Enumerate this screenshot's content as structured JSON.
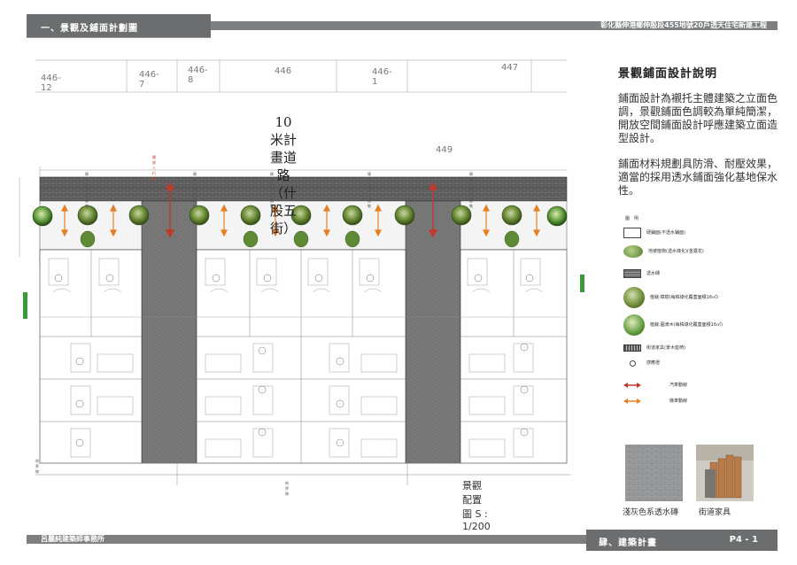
{
  "header": {
    "section": "一、景觀及鋪面計劃圖",
    "project": "彰化縣伸港鄉伸殷段455地號20戶透天住宅新建工程"
  },
  "footer": {
    "office": "呂麗純建築師事務所",
    "chapter": "肆、建築計畫",
    "page": "P4 - 1"
  },
  "panel": {
    "title": "景觀鋪面設計說明",
    "para1": "鋪面設計為襯托主體建築之立面色調，景觀鋪面色調較為單純簡潔，開放空間鋪面設計呼應建築立面造型設計。",
    "para2": "鋪面材料規劃具防滑、耐壓效果，適當的採用透水鋪面強化基地保水性。",
    "legend_title": "圖　例",
    "legend": [
      {
        "icon": "hardscape-box-icon",
        "label": "硬鋪面(不透水鋪面)"
      },
      {
        "icon": "groundcover-shrub-icon",
        "label": "地被植物(透水綠化)(金露花)"
      },
      {
        "icon": "permeable-brick-icon",
        "label": "透水磚"
      },
      {
        "icon": "tree-camphor-icon",
        "label": "植栽:樟樹(每株綠化覆蓋面積16㎡)"
      },
      {
        "icon": "tree-round-icon",
        "label": "植栽:圓滴木(每株綠化覆蓋面積16㎡)"
      },
      {
        "icon": "street-furniture-icon",
        "label": "街道家具(景木座椅)"
      },
      {
        "icon": "sensor-light-icon",
        "label": "感應燈"
      },
      {
        "icon": "car-route-icon",
        "label": "汽車動線"
      },
      {
        "icon": "bike-route-icon",
        "label": "機車動線"
      }
    ],
    "photo1_caption": "淺灰色系透水磚",
    "photo2_caption": "街道家具",
    "colors": {
      "car_route": "#c0392b",
      "bike_route": "#e67e22",
      "band": "#7d7f80"
    }
  },
  "plan": {
    "road_title_1": "10米計畫道路",
    "road_title_2": "（什股五街）",
    "lots": [
      "446-12",
      "446-7",
      "446-8",
      "446",
      "446-1",
      "447",
      "449"
    ],
    "scale_label": "景觀配置圖 S : 1/200",
    "marks": {
      "ramp": "開放人行道",
      "pave_label": "騎樓人行道鋪裝",
      "unit_labels": [
        "A1",
        "A2",
        "A3",
        "A4",
        "A5",
        "A6",
        "A7",
        "A8",
        "A9"
      ],
      "bottom_labels": [
        "地界線",
        "地界線"
      ]
    }
  }
}
